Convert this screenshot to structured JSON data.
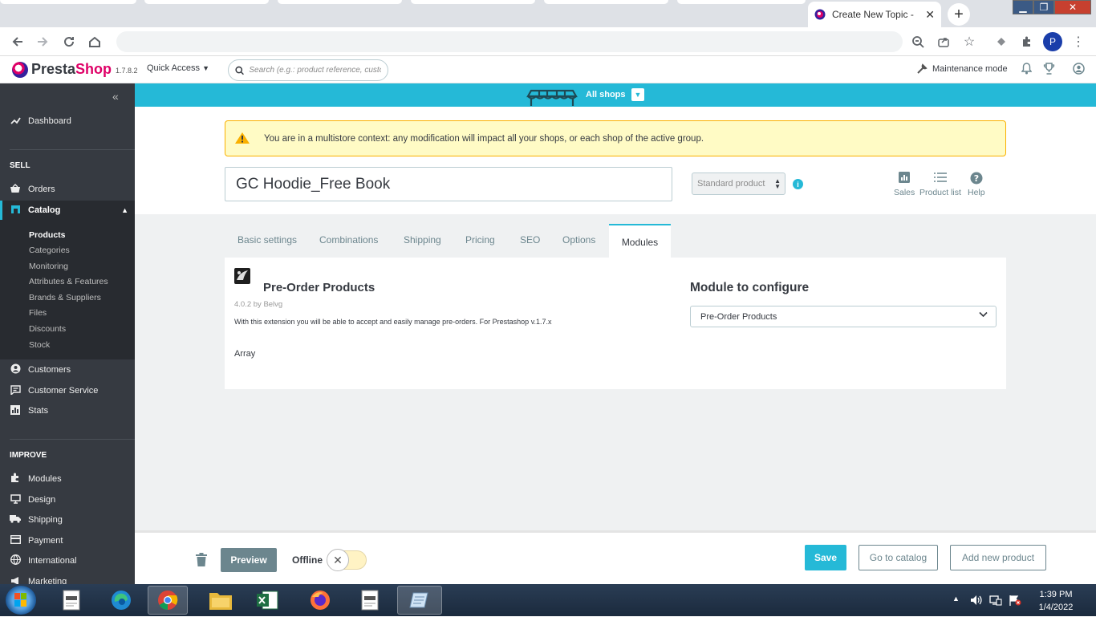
{
  "browser": {
    "active_tab_title": "Create New Topic -",
    "profile_initial": "P",
    "address": ""
  },
  "header": {
    "brand_prefix": "Presta",
    "brand_suffix": "Shop",
    "version": "1.7.8.2",
    "quick_access": "Quick Access",
    "search_placeholder": "Search (e.g.: product reference, custon",
    "maintenance": "Maintenance mode"
  },
  "sidebar": {
    "dashboard": "Dashboard",
    "sell_section": "SELL",
    "orders": "Orders",
    "catalog": "Catalog",
    "catalog_items": [
      "Products",
      "Categories",
      "Monitoring",
      "Attributes & Features",
      "Brands & Suppliers",
      "Files",
      "Discounts",
      "Stock"
    ],
    "customers": "Customers",
    "customer_service": "Customer Service",
    "stats": "Stats",
    "improve_section": "IMPROVE",
    "modules": "Modules",
    "design": "Design",
    "shipping": "Shipping",
    "payment": "Payment",
    "international": "International",
    "marketing": "Marketing"
  },
  "shopbar": {
    "label": "All shops"
  },
  "alert": {
    "text": "You are in a multistore context: any modification will impact all your shops, or each shop of the active group."
  },
  "product": {
    "name": "GC Hoodie_Free Book",
    "type": "Standard product",
    "links": {
      "sales": "Sales",
      "product_list": "Product list",
      "help": "Help"
    }
  },
  "tabs": [
    "Basic settings",
    "Combinations",
    "Shipping",
    "Pricing",
    "SEO",
    "Options",
    "Modules"
  ],
  "module": {
    "title": "Pre-Order Products",
    "version_by": "4.0.2 by Belvg",
    "description": "With this extension you will be able to accept and easily manage pre-orders. For Prestashop v.1.7.x",
    "array_text": "Array",
    "configure_title": "Module to configure",
    "configure_selected": "Pre-Order Products"
  },
  "footer": {
    "preview": "Preview",
    "offline": "Offline",
    "save": "Save",
    "go_to_catalog": "Go to catalog",
    "add_new_product": "Add new product"
  },
  "taskbar": {
    "time": "1:39 PM",
    "date": "1/4/2022"
  },
  "colors": {
    "accent": "#25b9d7",
    "brand_pink": "#df0067",
    "sidebar": "#363a41",
    "alert_bg": "#fffbc5"
  }
}
